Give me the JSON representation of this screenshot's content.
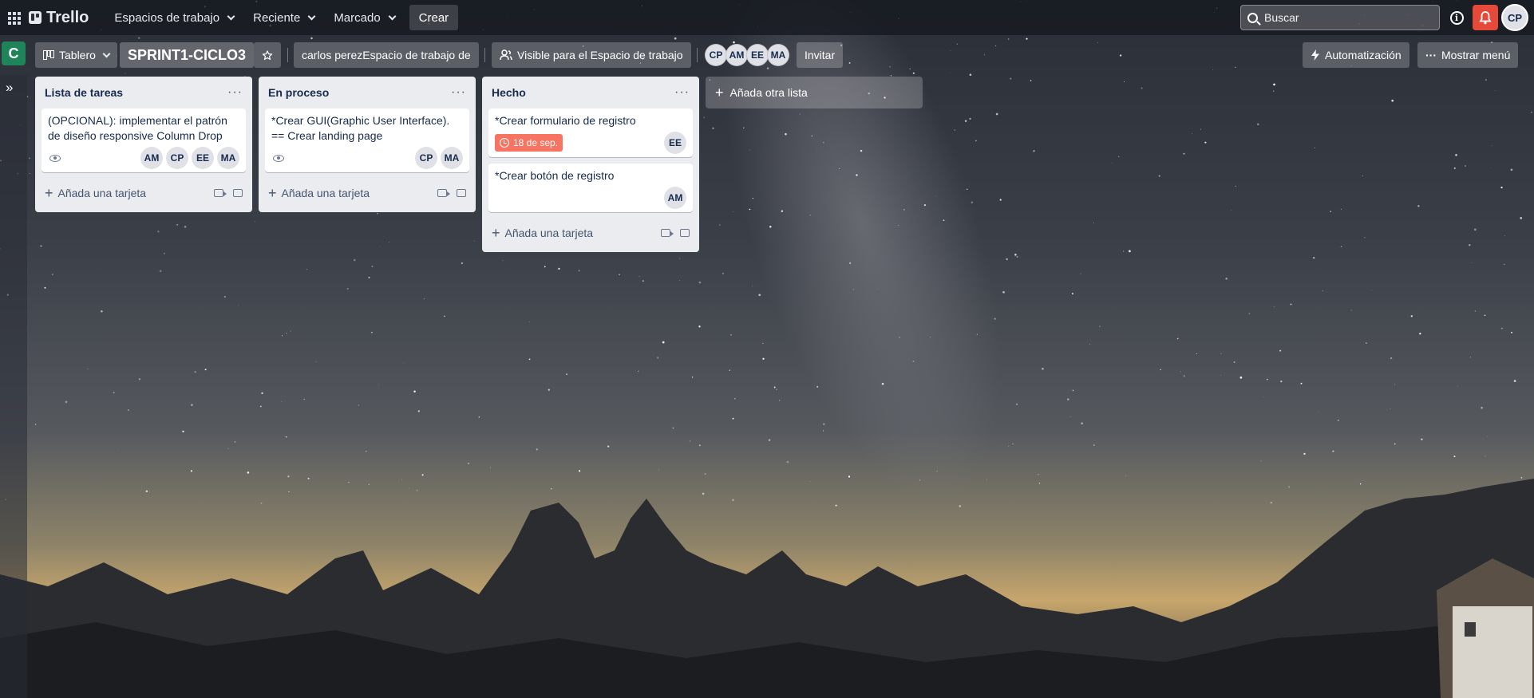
{
  "header": {
    "logo_text": "Trello",
    "nav": [
      {
        "label": "Espacios de trabajo"
      },
      {
        "label": "Reciente"
      },
      {
        "label": "Marcado"
      }
    ],
    "create_label": "Crear",
    "search_placeholder": "Buscar",
    "info_icon": "i",
    "user_initials": "CP"
  },
  "board": {
    "workspace_initial": "C",
    "view_label": "Tablero",
    "title": "SPRINT1-CICLO3",
    "workspace_button": "carlos perezEspacio de trabajo de",
    "visibility_label": "Visible para el Espacio de trabajo",
    "members": [
      "CP",
      "AM",
      "EE",
      "MA"
    ],
    "invite_label": "Invitar",
    "automation_label": "Automatización",
    "menu_label": "Mostrar menú",
    "sidebar_toggle": "»"
  },
  "lists": [
    {
      "title": "Lista de tareas",
      "cards": [
        {
          "title": "(OPCIONAL): implementar el patrón de diseño responsive Column Drop",
          "watched": true,
          "members": [
            "AM",
            "CP",
            "EE",
            "MA"
          ]
        }
      ],
      "add_card_label": "Añada una tarjeta"
    },
    {
      "title": "En proceso",
      "cards": [
        {
          "title": "*Crear GUI(Graphic User Interface). == Crear landing page",
          "watched": true,
          "members": [
            "CP",
            "MA"
          ]
        }
      ],
      "add_card_label": "Añada una tarjeta"
    },
    {
      "title": "Hecho",
      "cards": [
        {
          "title": "*Crear formulario de registro",
          "due": "18 de sep.",
          "members": [
            "EE"
          ]
        },
        {
          "title": "*Crear botón de registro",
          "members": [
            "AM"
          ]
        }
      ],
      "add_card_label": "Añada una tarjeta"
    }
  ],
  "add_list_label": "Añada otra lista",
  "colors": {
    "workspace_badge": "#1f845a",
    "due_badge": "#f87462",
    "notification": "#e5493a",
    "list_bg": "#ebecf0"
  }
}
